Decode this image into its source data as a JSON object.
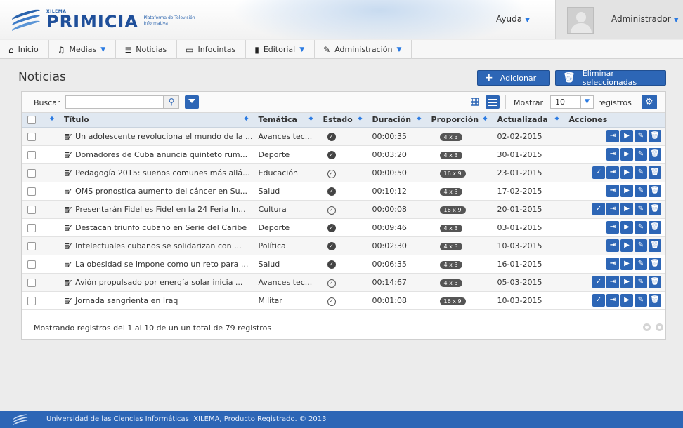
{
  "header": {
    "brand_small": "XILEMA",
    "brand_name": "PRIMICIA",
    "brand_subtitle": "Plataforma de Televisión Informativa",
    "help_label": "Ayuda",
    "user_label": "Administrador"
  },
  "nav": {
    "items": [
      {
        "label": "Inicio",
        "icon": "home-icon",
        "dropdown": false
      },
      {
        "label": "Medias",
        "icon": "music-icon",
        "dropdown": true
      },
      {
        "label": "Noticias",
        "icon": "news-icon",
        "dropdown": false
      },
      {
        "label": "Infocintas",
        "icon": "ticker-icon",
        "dropdown": false
      },
      {
        "label": "Editorial",
        "icon": "editorial-icon",
        "dropdown": true
      },
      {
        "label": "Administración",
        "icon": "wrench-icon",
        "dropdown": true
      }
    ]
  },
  "page": {
    "title": "Noticias",
    "add_label": "Adicionar",
    "delete_selected_label": "Eliminar seleccionadas"
  },
  "toolbar": {
    "search_label": "Buscar",
    "search_value": "",
    "show_label": "Mostrar",
    "show_value": "10",
    "records_label": "registros"
  },
  "table": {
    "columns": [
      "Título",
      "Temática",
      "Estado",
      "Duración",
      "Proporción",
      "Actualizada",
      "Acciones"
    ],
    "rows": [
      {
        "title": "Un adolescente revoluciona el mundo de la ...",
        "topic": "Avances tec...",
        "state": "ok",
        "duration": "00:00:35",
        "ratio": "4 x 3",
        "updated": "02-02-2015",
        "approve": false
      },
      {
        "title": "Domadores de Cuba anuncia quinteto rum...",
        "topic": "Deporte",
        "state": "ok",
        "duration": "00:03:20",
        "ratio": "4 x 3",
        "updated": "30-01-2015",
        "approve": false
      },
      {
        "title": "Pedagogía 2015: sueños comunes más allá...",
        "topic": "Educación",
        "state": "pending",
        "duration": "00:00:50",
        "ratio": "16 x 9",
        "updated": "23-01-2015",
        "approve": true
      },
      {
        "title": "OMS pronostica aumento del cáncer en Su...",
        "topic": "Salud",
        "state": "ok",
        "duration": "00:10:12",
        "ratio": "4 x 3",
        "updated": "17-02-2015",
        "approve": false
      },
      {
        "title": "Presentarán Fidel es Fidel en la 24 Feria In...",
        "topic": "Cultura",
        "state": "pending",
        "duration": "00:00:08",
        "ratio": "16 x 9",
        "updated": "20-01-2015",
        "approve": true
      },
      {
        "title": "Destacan triunfo cubano en Serie del Caribe",
        "topic": "Deporte",
        "state": "ok",
        "duration": "00:09:46",
        "ratio": "4 x 3",
        "updated": "03-01-2015",
        "approve": false
      },
      {
        "title": "Intelectuales cubanos se solidarizan con ...",
        "topic": "Política",
        "state": "ok",
        "duration": "00:02:30",
        "ratio": "4 x 3",
        "updated": "10-03-2015",
        "approve": false
      },
      {
        "title": "La obesidad se impone como un reto para ...",
        "topic": "Salud",
        "state": "ok",
        "duration": "00:06:35",
        "ratio": "4 x 3",
        "updated": "16-01-2015",
        "approve": false
      },
      {
        "title": "Avión propulsado por energía solar inicia ...",
        "topic": "Avances tec...",
        "state": "pending",
        "duration": "00:14:67",
        "ratio": "4 x 3",
        "updated": "05-03-2015",
        "approve": true
      },
      {
        "title": "Jornada sangrienta en Iraq",
        "topic": "Militar",
        "state": "pending",
        "duration": "00:01:08",
        "ratio": "16 x 9",
        "updated": "10-03-2015",
        "approve": true
      }
    ]
  },
  "footer_info": "Mostrando registros del 1 al 10 de un un total de 79 registros",
  "page_footer": "Universidad de las Ciencias Informáticas. XILEMA, Producto Registrado. © 2013",
  "colors": {
    "accent": "#2d66b6",
    "header_row": "#e0e8f1"
  }
}
